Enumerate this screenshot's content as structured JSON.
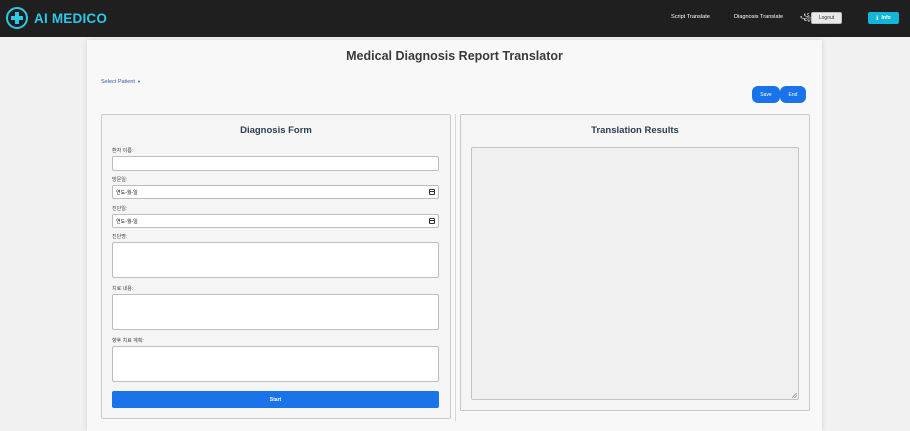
{
  "brand": {
    "name": "AI MEDICO",
    "accent_color": "#2ec8e6",
    "icon": "medical-cross-icon"
  },
  "nav": {
    "links": [
      "Script Translate",
      "Diagnosis Translate"
    ],
    "user_icon": "꧁",
    "logout_label": "Logout",
    "info_label": "Info",
    "info_icon": "info-icon"
  },
  "page": {
    "title": "Medical Diagnosis Report Translator",
    "select_patient": "Select Patient",
    "save_label": "Save",
    "end_label": "End"
  },
  "form": {
    "title": "Diagnosis Form",
    "patient_name_label": "환자 이름:",
    "patient_name_value": "",
    "visit_date_label": "방문일:",
    "visit_date_placeholder": "연도-월-일",
    "diagnosis_date_label": "진단일:",
    "diagnosis_date_placeholder": "연도-월-일",
    "diagnosis_label": "진단명:",
    "treatment_label": "치료 내용:",
    "plan_label": "향후 치료 계획:",
    "start_label": "Start"
  },
  "results": {
    "title": "Translation Results"
  },
  "colors": {
    "navbar": "#1f1f1f",
    "primary_button": "#1a73e8",
    "info_button": "#14b6d8"
  }
}
